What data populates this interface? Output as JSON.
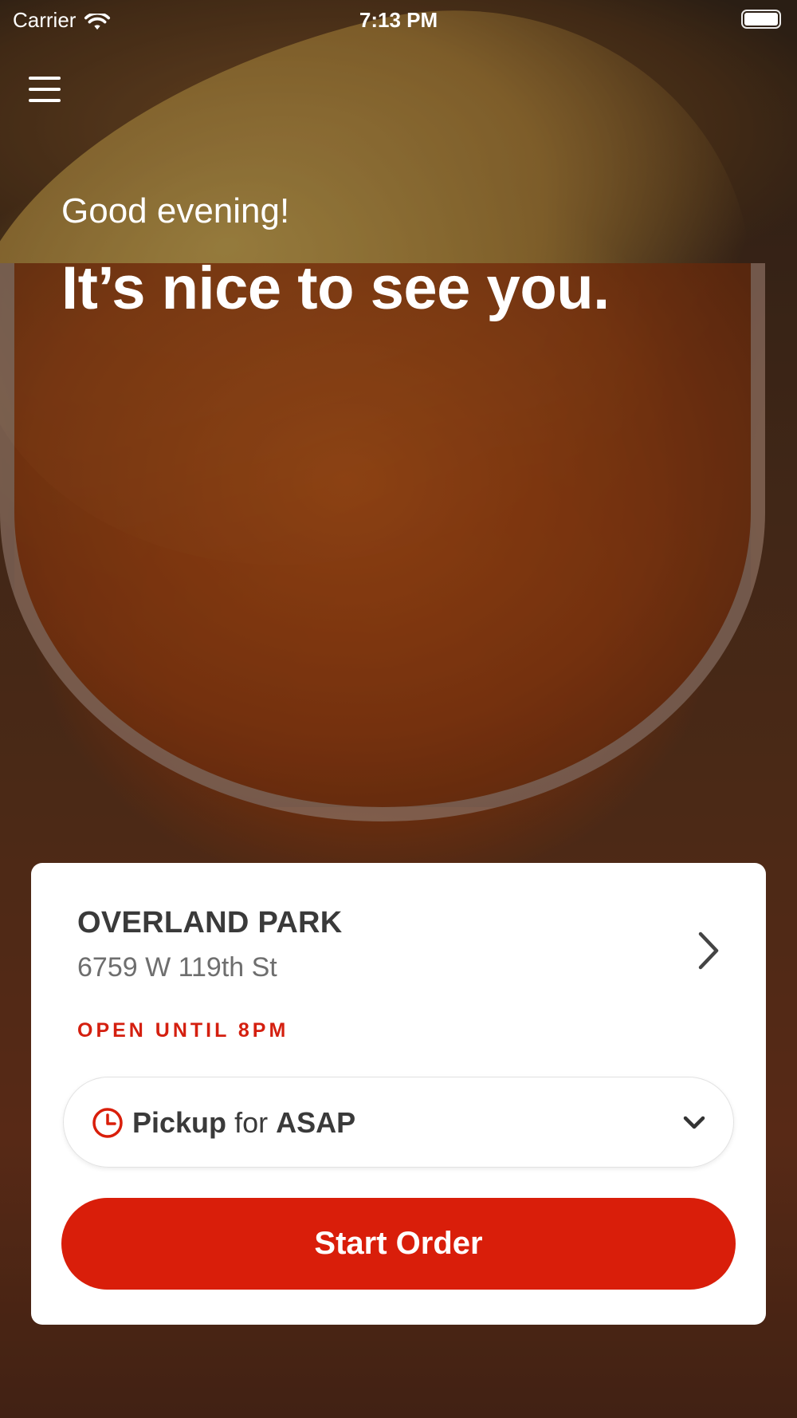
{
  "status_bar": {
    "carrier": "Carrier",
    "time": "7:13 PM"
  },
  "hero": {
    "greeting": "Good evening!",
    "headline": "It’s nice to see you."
  },
  "location_card": {
    "store_name": "OVERLAND PARK",
    "address": "6759 W 119th St",
    "status": "OPEN UNTIL 8PM",
    "order_mode": {
      "mode": "Pickup",
      "connector": "for",
      "time": "ASAP"
    },
    "start_order_label": "Start Order"
  },
  "colors": {
    "accent": "#d91e0a",
    "status_text": "#d41f0f",
    "title_text": "#3a3a3a",
    "address_text": "#6e6e6e"
  },
  "icons": {
    "menu": "hamburger-menu-icon",
    "location_detail": "chevron-right-icon",
    "pickup_time": "clock-icon",
    "dropdown": "chevron-down-icon",
    "wifi": "wifi-icon",
    "battery": "battery-icon"
  }
}
